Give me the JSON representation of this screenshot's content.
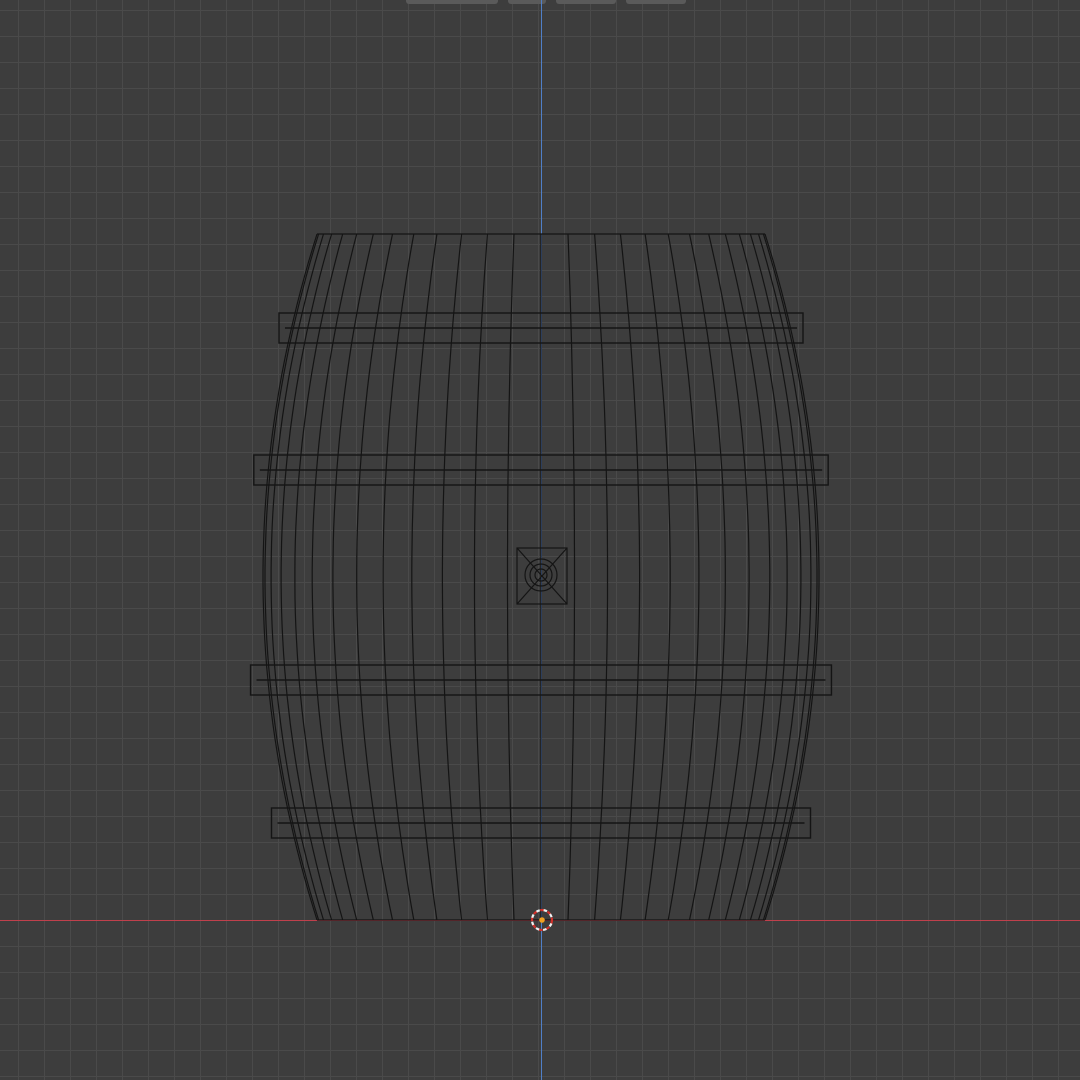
{
  "viewport": {
    "view": "front-orthographic",
    "shading": "wireframe",
    "grid": true,
    "colors": {
      "background": "#3d3d3d",
      "grid": "#4a4a4a",
      "x_axis": "#c0404c",
      "z_axis": "#4f7fc8",
      "wire": "#141414",
      "cursor_red": "#d0302a",
      "cursor_white": "#f0f0f0",
      "origin": "#f0a020"
    }
  },
  "header": {
    "tabs": [
      {
        "icon": "header-tab"
      },
      {
        "icon": "header-tab"
      },
      {
        "icon": "header-tab"
      },
      {
        "icon": "header-tab"
      }
    ]
  },
  "object": {
    "name_icon": "barrel-mesh",
    "features": [
      "staves",
      "hoops",
      "spigot-hole"
    ]
  },
  "cursor": {
    "icon": "3d-cursor-icon"
  }
}
